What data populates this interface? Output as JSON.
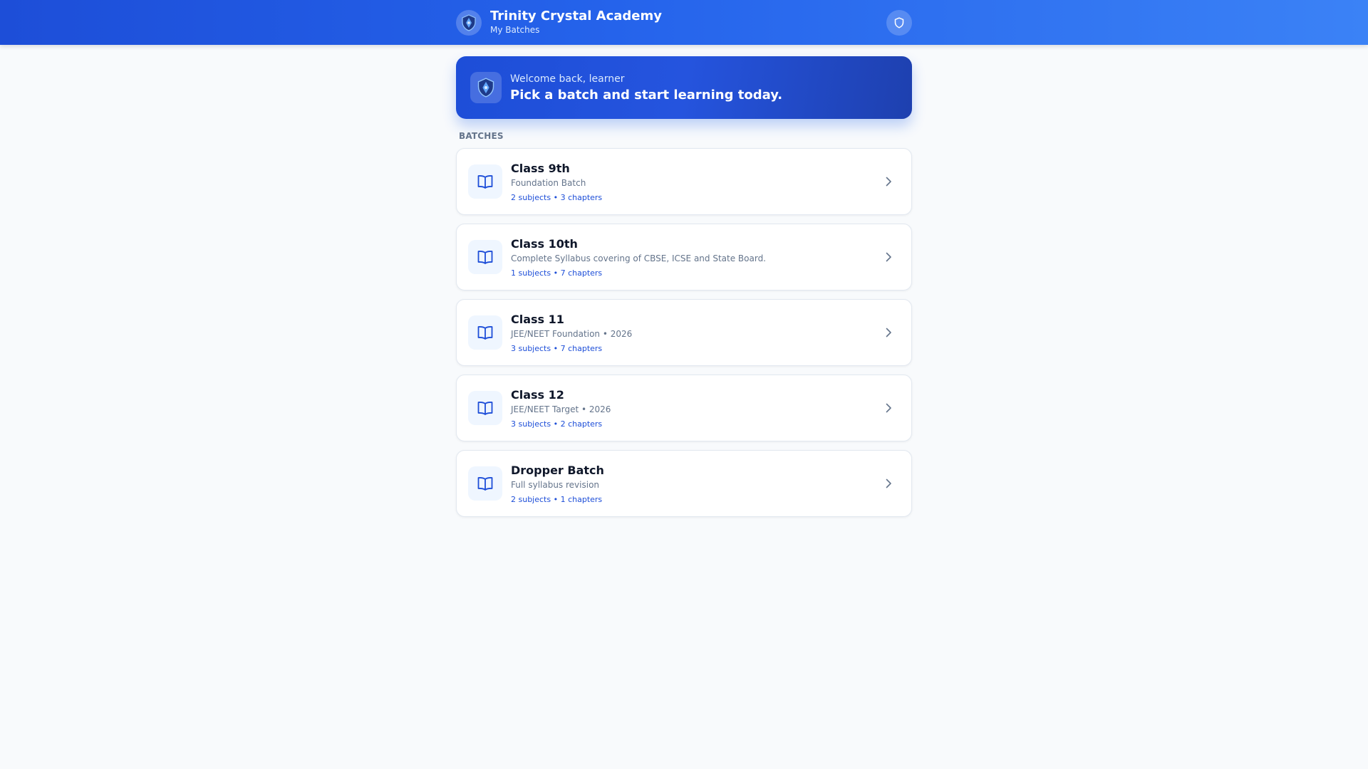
{
  "header": {
    "title": "Trinity Crystal Academy",
    "subtitle": "My Batches",
    "logo_icon": "shield-crest-icon",
    "action_icon": "shield-icon"
  },
  "welcome": {
    "greeting": "Welcome back, learner",
    "heading": "Pick a batch and start learning today."
  },
  "section": {
    "label": "BATCHES"
  },
  "batches": [
    {
      "title": "Class 9th",
      "description": "Foundation Batch",
      "meta": "2 subjects • 3 chapters"
    },
    {
      "title": "Class 10th",
      "description": "Complete Syllabus covering of CBSE, ICSE and State Board.",
      "meta": "1 subjects • 7 chapters"
    },
    {
      "title": "Class 11",
      "description": "JEE/NEET Foundation • 2026",
      "meta": "3 subjects • 7 chapters"
    },
    {
      "title": "Class 12",
      "description": "JEE/NEET Target • 2026",
      "meta": "3 subjects • 2 chapters"
    },
    {
      "title": "Dropper Batch",
      "description": "Full syllabus revision",
      "meta": "2 subjects • 1 chapters"
    }
  ],
  "colors": {
    "brand": "#2563eb",
    "brand_dark": "#1d4ed8",
    "accent_text": "#1d4ed8",
    "background": "#f8fafc"
  }
}
